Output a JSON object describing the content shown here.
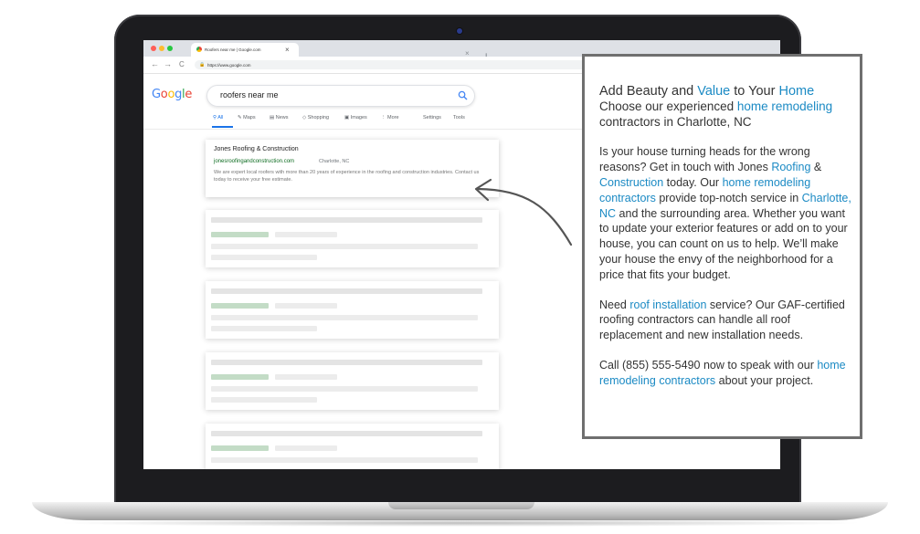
{
  "browser": {
    "tab_title": "Roofers near me | Google.com",
    "url": "https://www.google.com",
    "tab_close": "×",
    "new_tab": "+",
    "back": "←",
    "forward": "→",
    "reload": "C"
  },
  "google": {
    "logo_letters": [
      {
        "ch": "G",
        "color": "#4285f4"
      },
      {
        "ch": "o",
        "color": "#ea4335"
      },
      {
        "ch": "o",
        "color": "#fbbc05"
      },
      {
        "ch": "g",
        "color": "#4285f4"
      },
      {
        "ch": "l",
        "color": "#34a853"
      },
      {
        "ch": "e",
        "color": "#ea4335"
      }
    ],
    "query": "roofers near me",
    "tabs": {
      "all": "All",
      "maps": "Maps",
      "news": "News",
      "shopping": "Shopping",
      "images": "Images",
      "more": "More",
      "settings": "Settings",
      "tools": "Tools"
    },
    "result": {
      "title": "Jones Roofing & Construction",
      "url": "jonesroofingandconstruction.com",
      "location": "Charlotte, NC",
      "description": "We are expert local roofers with more than 20 years of experience in the roofing and construction industries. Contact us today to receive your free estimate."
    }
  },
  "card": {
    "h1_a": "Add Beauty and ",
    "h1_b": "Value",
    "h1_c": " to Your ",
    "h1_d": "Home",
    "h2_a": "Choose our experienced ",
    "h2_b": "home remodeling",
    "h2_c": "contractors in Charlotte, NC",
    "p1_a": "Is your house turning heads for the wrong reasons? Get in touch with Jones ",
    "p1_b": "Roofing",
    "p1_c": "  & ",
    "p1_d": "Construction",
    "p1_e": " today. Our ",
    "p1_f": "home remodeling contractors",
    "p1_g": " provide top-notch service in ",
    "p1_h": "Charlotte, NC",
    "p1_i": " and the surrounding area. Whether you want to update your exterior features or add on to your house, you can count on us to help. We’ll make your house the envy of the neighborhood for a price that fits your budget.",
    "p2_a": "Need ",
    "p2_b": "roof installation",
    "p2_c": " service? Our GAF-certified roofing contractors can handle all roof replacement and new installation needs.",
    "p3_a": "Call (855) 555-5490 now to speak with our ",
    "p3_b": "home remodeling contractors",
    "p3_c": " about your project."
  },
  "colors": {
    "accent": "#1b8ac4",
    "link_green": "#0b6b1f",
    "google_blue": "#1a73e8",
    "placeholder_gray": "#e4e4e4",
    "placeholder_green": "#c3dcc6"
  }
}
